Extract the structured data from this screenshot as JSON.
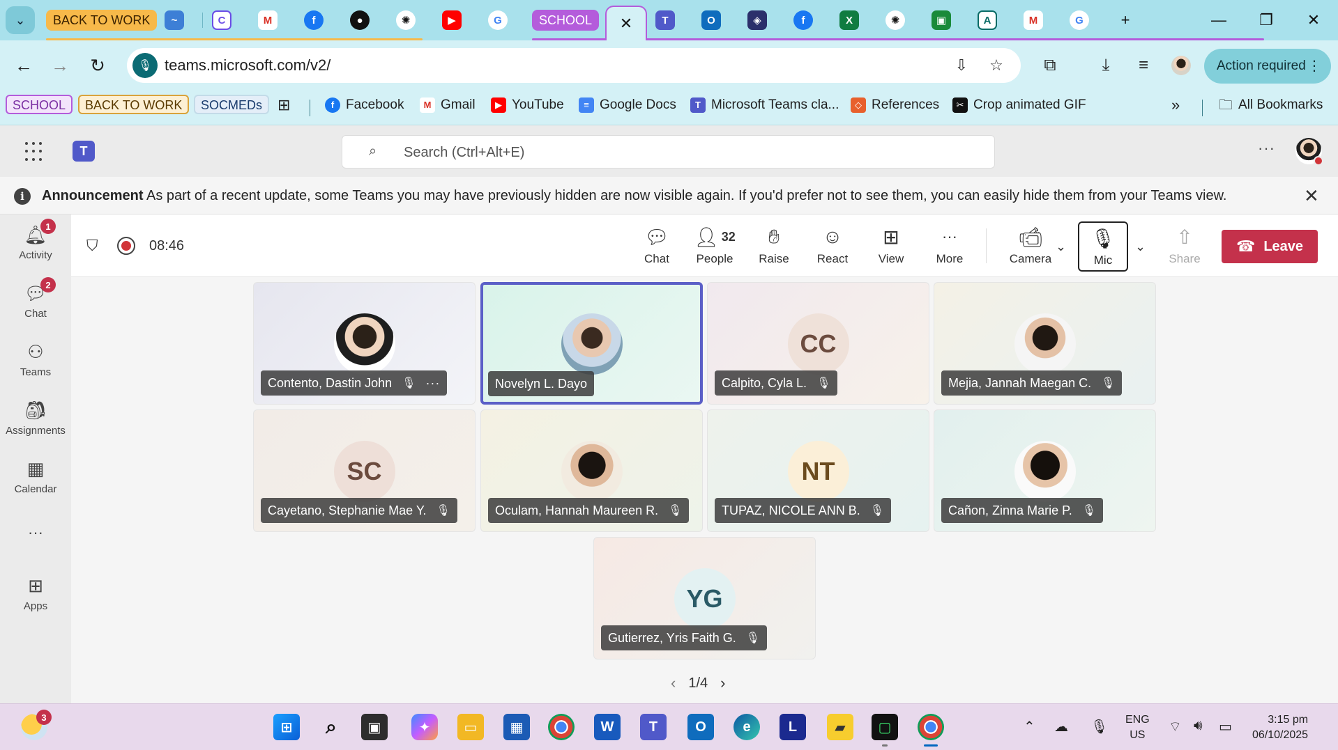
{
  "browser": {
    "tab_groups": {
      "work": "BACK TO WORK",
      "school": "SCHOOL"
    },
    "active_tab_close": "✕",
    "new_tab": "+",
    "window_controls": {
      "minimize": "—",
      "restore": "❐",
      "close": "✕"
    },
    "url": "teams.microsoft.com/v2/",
    "action_required": "Action required",
    "bookmark_groups": [
      "SCHOOL",
      "BACK TO WORK",
      "SOCMEDs"
    ],
    "bookmarks": [
      "Facebook",
      "Gmail",
      "YouTube",
      "Google Docs",
      "Microsoft Teams cla...",
      "References",
      "Crop animated GIF"
    ],
    "all_bookmarks": "All Bookmarks",
    "overflow": "»"
  },
  "teams": {
    "search_placeholder": "Search (Ctrl+Alt+E)",
    "announcement": {
      "title": "Announcement",
      "text": "As part of a recent update, some Teams you may have previously hidden are now visible again. If you'd prefer not to see them, you can easily hide them from your Teams view."
    },
    "rail": [
      {
        "label": "Activity",
        "badge": "1",
        "icon": "bell-icon"
      },
      {
        "label": "Chat",
        "badge": "2",
        "icon": "chat-icon"
      },
      {
        "label": "Teams",
        "badge": "",
        "icon": "teams-icon"
      },
      {
        "label": "Assignments",
        "badge": "",
        "icon": "assignments-icon"
      },
      {
        "label": "Calendar",
        "badge": "",
        "icon": "calendar-icon"
      },
      {
        "label": "",
        "badge": "",
        "icon": "more-icon"
      },
      {
        "label": "Apps",
        "badge": "",
        "icon": "apps-icon"
      }
    ],
    "meeting": {
      "timer": "08:46",
      "people_count": "32",
      "buttons": {
        "chat": "Chat",
        "people": "People",
        "raise": "Raise",
        "react": "React",
        "view": "View",
        "more": "More",
        "camera": "Camera",
        "mic": "Mic",
        "share": "Share"
      },
      "leave": "Leave"
    },
    "participants": [
      {
        "name": "Contento, Dastin John",
        "initials": "",
        "avatar_color": "#ffffff"
      },
      {
        "name": "Novelyn L. Dayo",
        "initials": "",
        "avatar_color": "#c8d8e8"
      },
      {
        "name": "Calpito, Cyla L.",
        "initials": "CC",
        "avatar_color": "#f3e6df"
      },
      {
        "name": "Mejia, Jannah Maegan C.",
        "initials": "",
        "avatar_color": "#ffffff"
      },
      {
        "name": "Cayetano, Stephanie Mae Y.",
        "initials": "SC",
        "avatar_color": "#f1e3dc"
      },
      {
        "name": "Oculam, Hannah Maureen R.",
        "initials": "",
        "avatar_color": "#ffffff"
      },
      {
        "name": "TUPAZ, NICOLE ANN B.",
        "initials": "NT",
        "avatar_color": "#fbefd8"
      },
      {
        "name": "Cañon, Zinna Marie P.",
        "initials": "",
        "avatar_color": "#ffffff"
      },
      {
        "name": "Gutierrez, Yris Faith G.",
        "initials": "YG",
        "avatar_color": "#e3f1f2"
      }
    ],
    "pager": "1/4"
  },
  "taskbar": {
    "weather_badge": "3",
    "language": {
      "line1": "ENG",
      "line2": "US"
    },
    "time": "3:15 pm",
    "date": "06/10/2025"
  },
  "colors": {
    "accent": "#5b5fc7",
    "leave": "#c4314b",
    "tabstrip": "#a9e1ec",
    "toolbar": "#d4f1f6"
  }
}
